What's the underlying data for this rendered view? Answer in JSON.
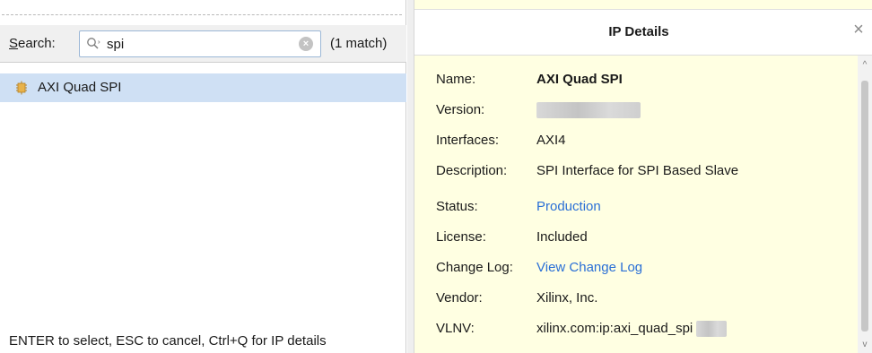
{
  "search": {
    "label_prefix": "S",
    "label_rest": "earch:",
    "value": "spi",
    "match_count": "(1 match)"
  },
  "results": [
    {
      "label": "AXI Quad SPI",
      "icon": "ip-core-icon"
    }
  ],
  "hint": "ENTER to select, ESC to cancel, Ctrl+Q for IP details",
  "details": {
    "title": "IP Details",
    "close_glyph": "×",
    "fields": {
      "name": {
        "key": "Name:",
        "value": "AXI Quad SPI"
      },
      "version": {
        "key": "Version:"
      },
      "interfaces": {
        "key": "Interfaces:",
        "value": "AXI4"
      },
      "description": {
        "key": "Description:",
        "value": "SPI Interface for SPI Based Slave"
      },
      "status": {
        "key": "Status:",
        "value": "Production"
      },
      "license": {
        "key": "License:",
        "value": "Included"
      },
      "change_log": {
        "key": "Change Log:",
        "value": "View Change Log"
      },
      "vendor": {
        "key": "Vendor:",
        "value": "Xilinx, Inc."
      },
      "vlnv": {
        "key": "VLNV:",
        "value": "xilinx.com:ip:axi_quad_spi"
      }
    }
  },
  "colors": {
    "selection": "#cfe0f4",
    "details_background": "#ffffe2",
    "link": "#2a6fd6"
  }
}
